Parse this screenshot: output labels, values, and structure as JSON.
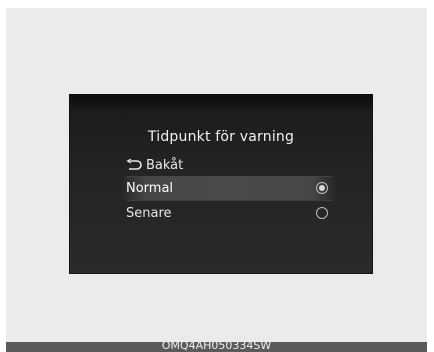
{
  "screen": {
    "title": "Tidpunkt för varning",
    "back_label": "Bakåt",
    "options": [
      {
        "label": "Normal",
        "selected": true
      },
      {
        "label": "Senare",
        "selected": false
      }
    ]
  },
  "caption": "OMQ4AH050334SW",
  "icons": {
    "back": "back-arrow-icon",
    "radio_selected": "radio-selected-icon",
    "radio_empty": "radio-empty-icon"
  },
  "colors": {
    "screen_bg": "#242424",
    "highlight": "#4a4a4a",
    "text": "#f2f2f2",
    "frame_bg": "#ebebeb"
  }
}
